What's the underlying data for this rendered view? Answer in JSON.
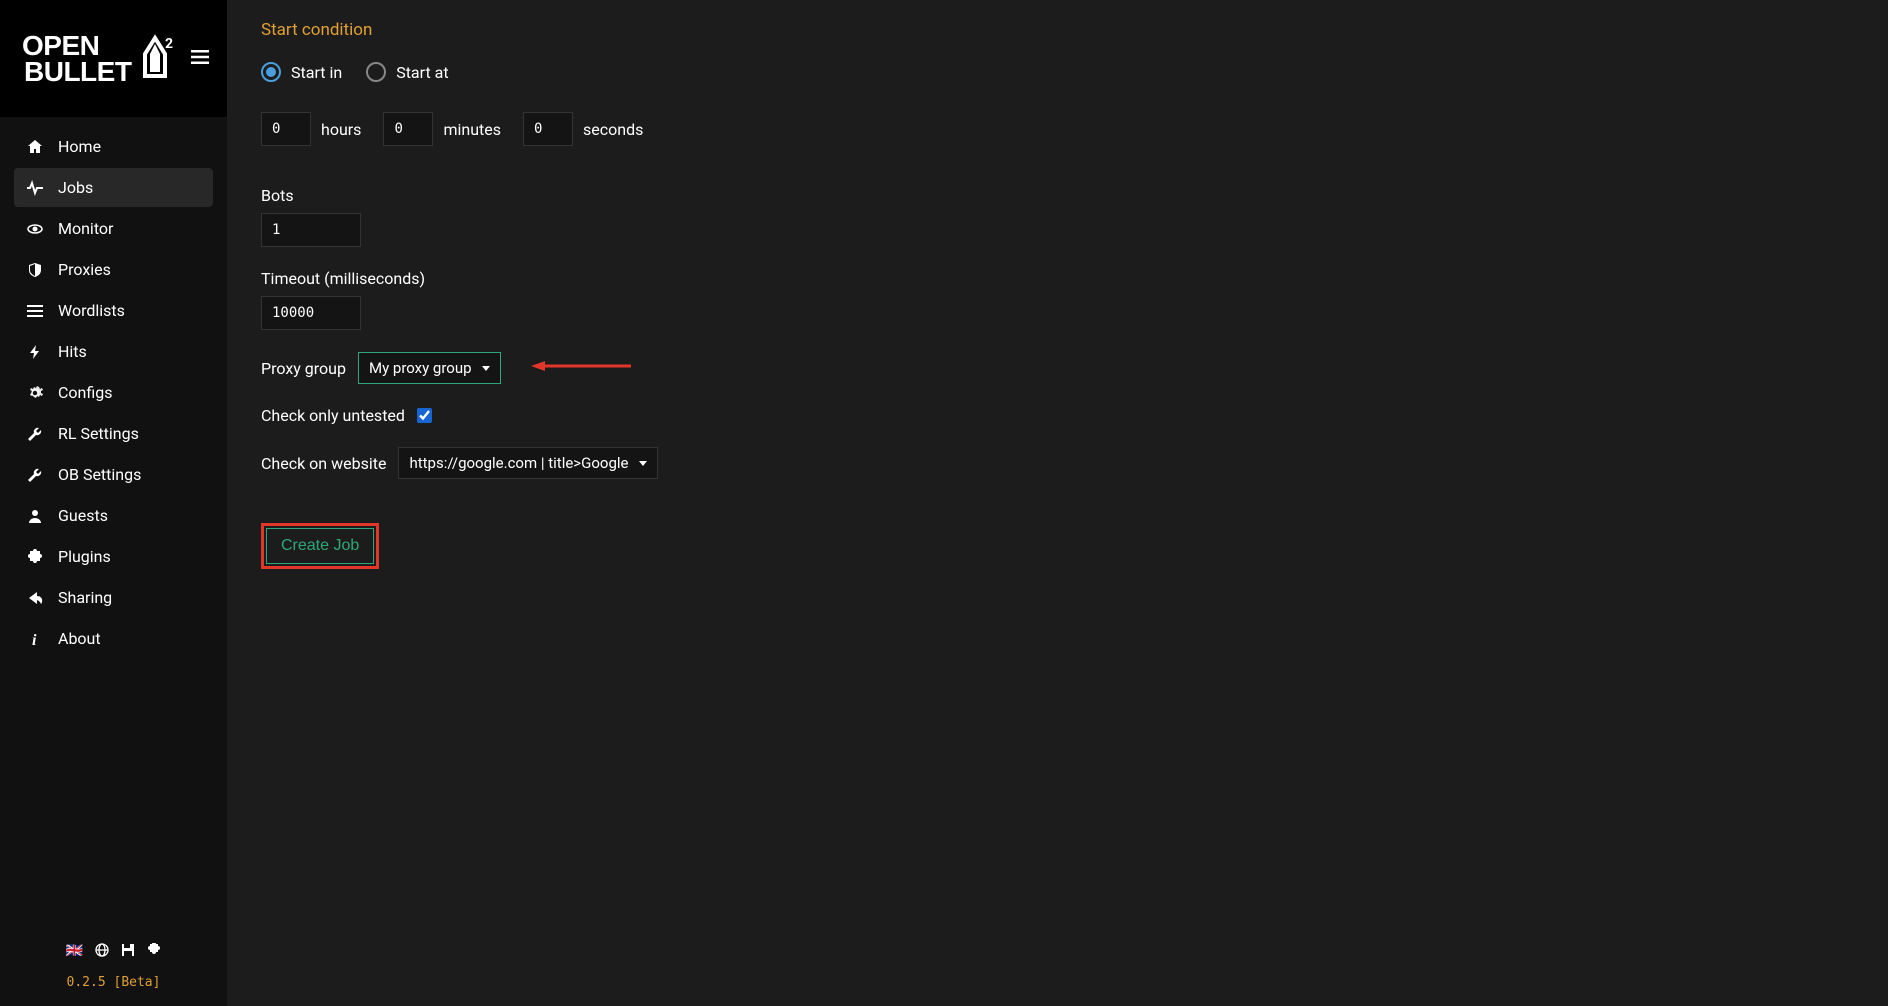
{
  "app_name": "OPEN BULLET 2",
  "sidebar": {
    "items": [
      {
        "label": "Home",
        "icon": "home"
      },
      {
        "label": "Jobs",
        "icon": "pulse",
        "active": true
      },
      {
        "label": "Monitor",
        "icon": "eye"
      },
      {
        "label": "Proxies",
        "icon": "shield"
      },
      {
        "label": "Wordlists",
        "icon": "list"
      },
      {
        "label": "Hits",
        "icon": "bolt"
      },
      {
        "label": "Configs",
        "icon": "gear"
      },
      {
        "label": "RL Settings",
        "icon": "wrench"
      },
      {
        "label": "OB Settings",
        "icon": "wrench"
      },
      {
        "label": "Guests",
        "icon": "user"
      },
      {
        "label": "Plugins",
        "icon": "puzzle"
      },
      {
        "label": "Sharing",
        "icon": "share"
      },
      {
        "label": "About",
        "icon": "info"
      }
    ]
  },
  "footer": {
    "version": "0.2.5 [Beta]"
  },
  "form": {
    "section_title": "Start condition",
    "start_in_label": "Start in",
    "start_at_label": "Start at",
    "start_mode": "in",
    "hours": "0",
    "hours_label": "hours",
    "minutes": "0",
    "minutes_label": "minutes",
    "seconds": "0",
    "seconds_label": "seconds",
    "bots_label": "Bots",
    "bots_value": "1",
    "timeout_label": "Timeout (milliseconds)",
    "timeout_value": "10000",
    "proxy_group_label": "Proxy group",
    "proxy_group_value": "My proxy group",
    "check_untested_label": "Check only untested",
    "check_untested": true,
    "check_website_label": "Check on website",
    "check_website_value": "https://google.com | title>Google",
    "create_button": "Create Job"
  }
}
